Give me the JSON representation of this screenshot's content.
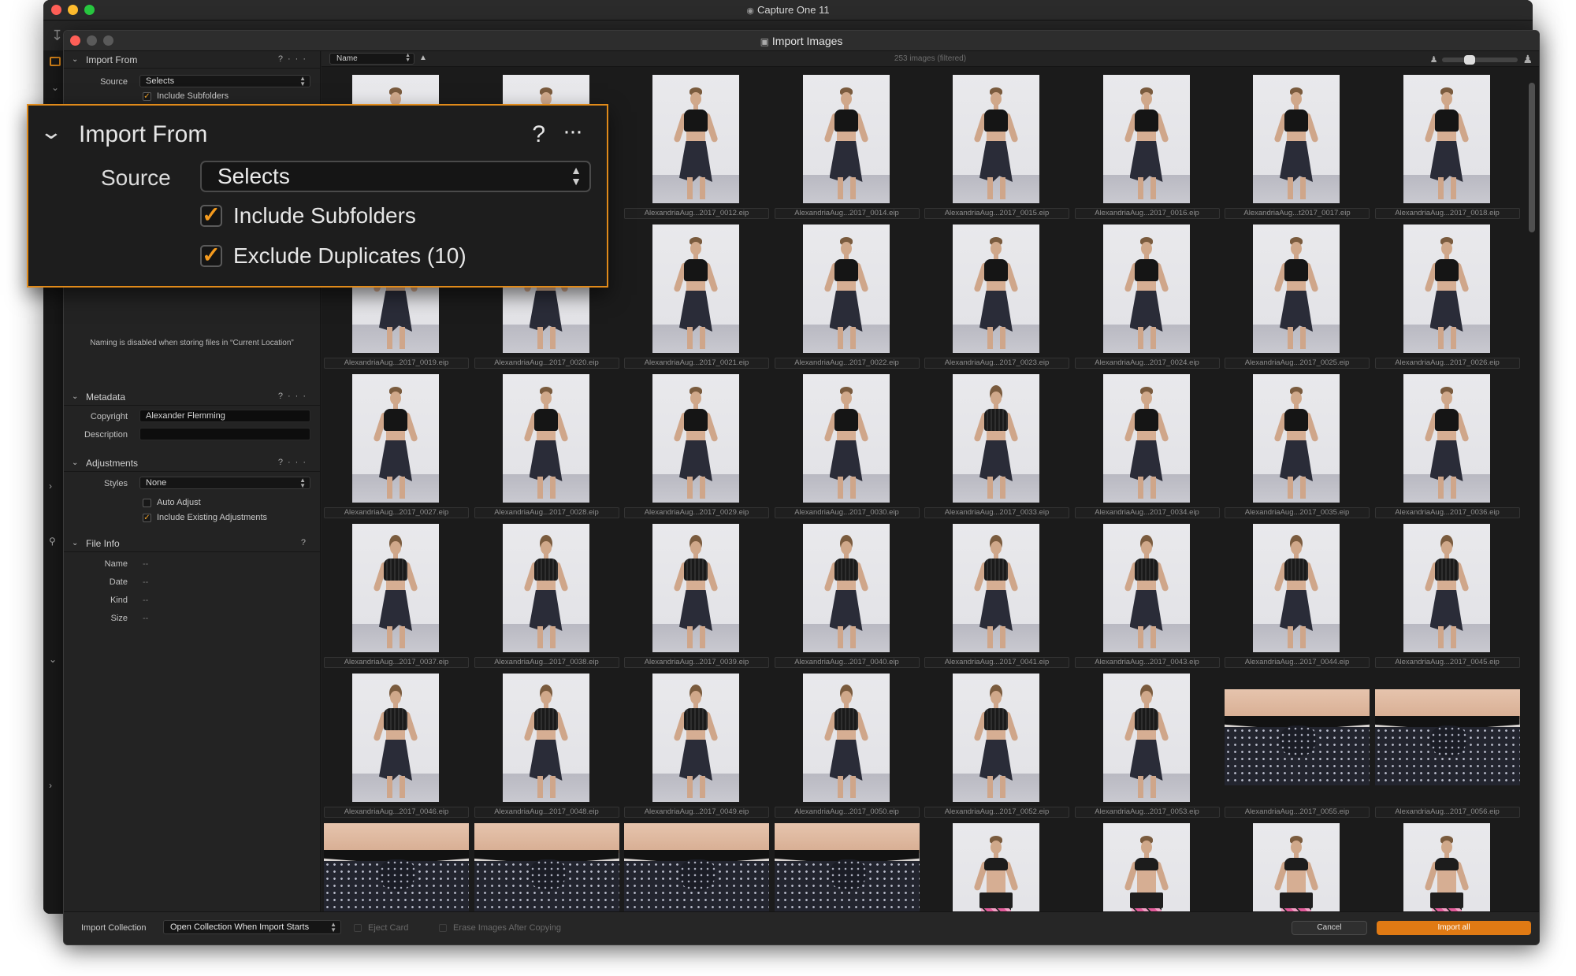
{
  "app": {
    "title": "Capture One 11",
    "dialog_title": "Import Images"
  },
  "callout": {
    "section_title": "Import From",
    "help": "?",
    "more": "···",
    "source_label": "Source",
    "source_value": "Selects",
    "include_subfolders": "Include Subfolders",
    "exclude_duplicates": "Exclude Duplicates (10)"
  },
  "left_panel": {
    "import_from": {
      "title": "Import From",
      "source_label": "Source",
      "source_value": "Selects",
      "include_subfolders": "Include Subfolders"
    },
    "naming_note": "Naming is disabled when storing files in “Current Location”",
    "metadata": {
      "title": "Metadata",
      "copyright_label": "Copyright",
      "copyright_value": "Alexander Flemming",
      "description_label": "Description",
      "description_value": ""
    },
    "adjustments": {
      "title": "Adjustments",
      "styles_label": "Styles",
      "styles_value": "None",
      "auto_adjust": "Auto Adjust",
      "include_existing": "Include Existing Adjustments"
    },
    "file_info": {
      "title": "File Info",
      "fields": [
        {
          "label": "Name",
          "value": "--"
        },
        {
          "label": "Date",
          "value": "--"
        },
        {
          "label": "Kind",
          "value": "--"
        },
        {
          "label": "Size",
          "value": "--"
        }
      ]
    }
  },
  "grid": {
    "sort_by": "Name",
    "sort_direction": "▲",
    "image_count": "253 images (filtered)",
    "thumbnails": [
      {
        "caption": "",
        "kind": "pose"
      },
      {
        "caption": "",
        "kind": "pose"
      },
      {
        "caption": "AlexandriaAug...2017_0012.eip",
        "kind": "pose"
      },
      {
        "caption": "AlexandriaAug...2017_0014.eip",
        "kind": "pose"
      },
      {
        "caption": "AlexandriaAug...2017_0015.eip",
        "kind": "pose"
      },
      {
        "caption": "AlexandriaAug...2017_0016.eip",
        "kind": "pose"
      },
      {
        "caption": "AlexandriaAug...t2017_0017.eip",
        "kind": "pose"
      },
      {
        "caption": "AlexandriaAug...2017_0018.eip",
        "kind": "pose"
      },
      {
        "caption": "AlexandriaAug...2017_0019.eip",
        "kind": "pose"
      },
      {
        "caption": "AlexandriaAug...2017_0020.eip",
        "kind": "pose"
      },
      {
        "caption": "AlexandriaAug...2017_0021.eip",
        "kind": "pose"
      },
      {
        "caption": "AlexandriaAug...2017_0022.eip",
        "kind": "pose"
      },
      {
        "caption": "AlexandriaAug...2017_0023.eip",
        "kind": "pose"
      },
      {
        "caption": "AlexandriaAug...2017_0024.eip",
        "kind": "pose"
      },
      {
        "caption": "AlexandriaAug...2017_0025.eip",
        "kind": "pose"
      },
      {
        "caption": "AlexandriaAug...2017_0026.eip",
        "kind": "pose"
      },
      {
        "caption": "AlexandriaAug...2017_0027.eip",
        "kind": "pose"
      },
      {
        "caption": "AlexandriaAug...2017_0028.eip",
        "kind": "pose"
      },
      {
        "caption": "AlexandriaAug...2017_0029.eip",
        "kind": "pose"
      },
      {
        "caption": "AlexandriaAug...2017_0030.eip",
        "kind": "pose"
      },
      {
        "caption": "AlexandriaAug...2017_0033.eip",
        "kind": "back"
      },
      {
        "caption": "AlexandriaAug...2017_0034.eip",
        "kind": "pose"
      },
      {
        "caption": "AlexandriaAug...2017_0035.eip",
        "kind": "pose"
      },
      {
        "caption": "AlexandriaAug...2017_0036.eip",
        "kind": "pose"
      },
      {
        "caption": "AlexandriaAug...2017_0037.eip",
        "kind": "back"
      },
      {
        "caption": "AlexandriaAug...2017_0038.eip",
        "kind": "back"
      },
      {
        "caption": "AlexandriaAug...2017_0039.eip",
        "kind": "back"
      },
      {
        "caption": "AlexandriaAug...2017_0040.eip",
        "kind": "back"
      },
      {
        "caption": "AlexandriaAug...2017_0041.eip",
        "kind": "back"
      },
      {
        "caption": "AlexandriaAug...2017_0043.eip",
        "kind": "back"
      },
      {
        "caption": "AlexandriaAug...2017_0044.eip",
        "kind": "back"
      },
      {
        "caption": "AlexandriaAug...2017_0045.eip",
        "kind": "back"
      },
      {
        "caption": "AlexandriaAug...2017_0046.eip",
        "kind": "back"
      },
      {
        "caption": "AlexandriaAug...2017_0048.eip",
        "kind": "back"
      },
      {
        "caption": "AlexandriaAug...2017_0049.eip",
        "kind": "back"
      },
      {
        "caption": "AlexandriaAug...2017_0050.eip",
        "kind": "back"
      },
      {
        "caption": "AlexandriaAug...2017_0052.eip",
        "kind": "back"
      },
      {
        "caption": "AlexandriaAug...2017_0053.eip",
        "kind": "back"
      },
      {
        "caption": "AlexandriaAug...2017_0055.eip",
        "kind": "detail"
      },
      {
        "caption": "AlexandriaAug...2017_0056.eip",
        "kind": "detail"
      },
      {
        "caption": "",
        "kind": "detail-crop"
      },
      {
        "caption": "",
        "kind": "detail-crop"
      },
      {
        "caption": "",
        "kind": "detail-crop"
      },
      {
        "caption": "",
        "kind": "detail-crop"
      },
      {
        "caption": "",
        "kind": "fitness"
      },
      {
        "caption": "",
        "kind": "fitness"
      },
      {
        "caption": "",
        "kind": "fitness"
      },
      {
        "caption": "",
        "kind": "fitness"
      }
    ]
  },
  "bottom_bar": {
    "import_collection_label": "Import Collection",
    "import_collection_value": "Open Collection When Import Starts",
    "eject_card": "Eject Card",
    "erase_images": "Erase Images After Copying",
    "cancel": "Cancel",
    "import_all": "Import all"
  },
  "colors": {
    "accent": "#e07a14",
    "callout_border": "#e08a1a",
    "panel_bg": "#232323",
    "grid_bg": "#1b1b1b"
  }
}
